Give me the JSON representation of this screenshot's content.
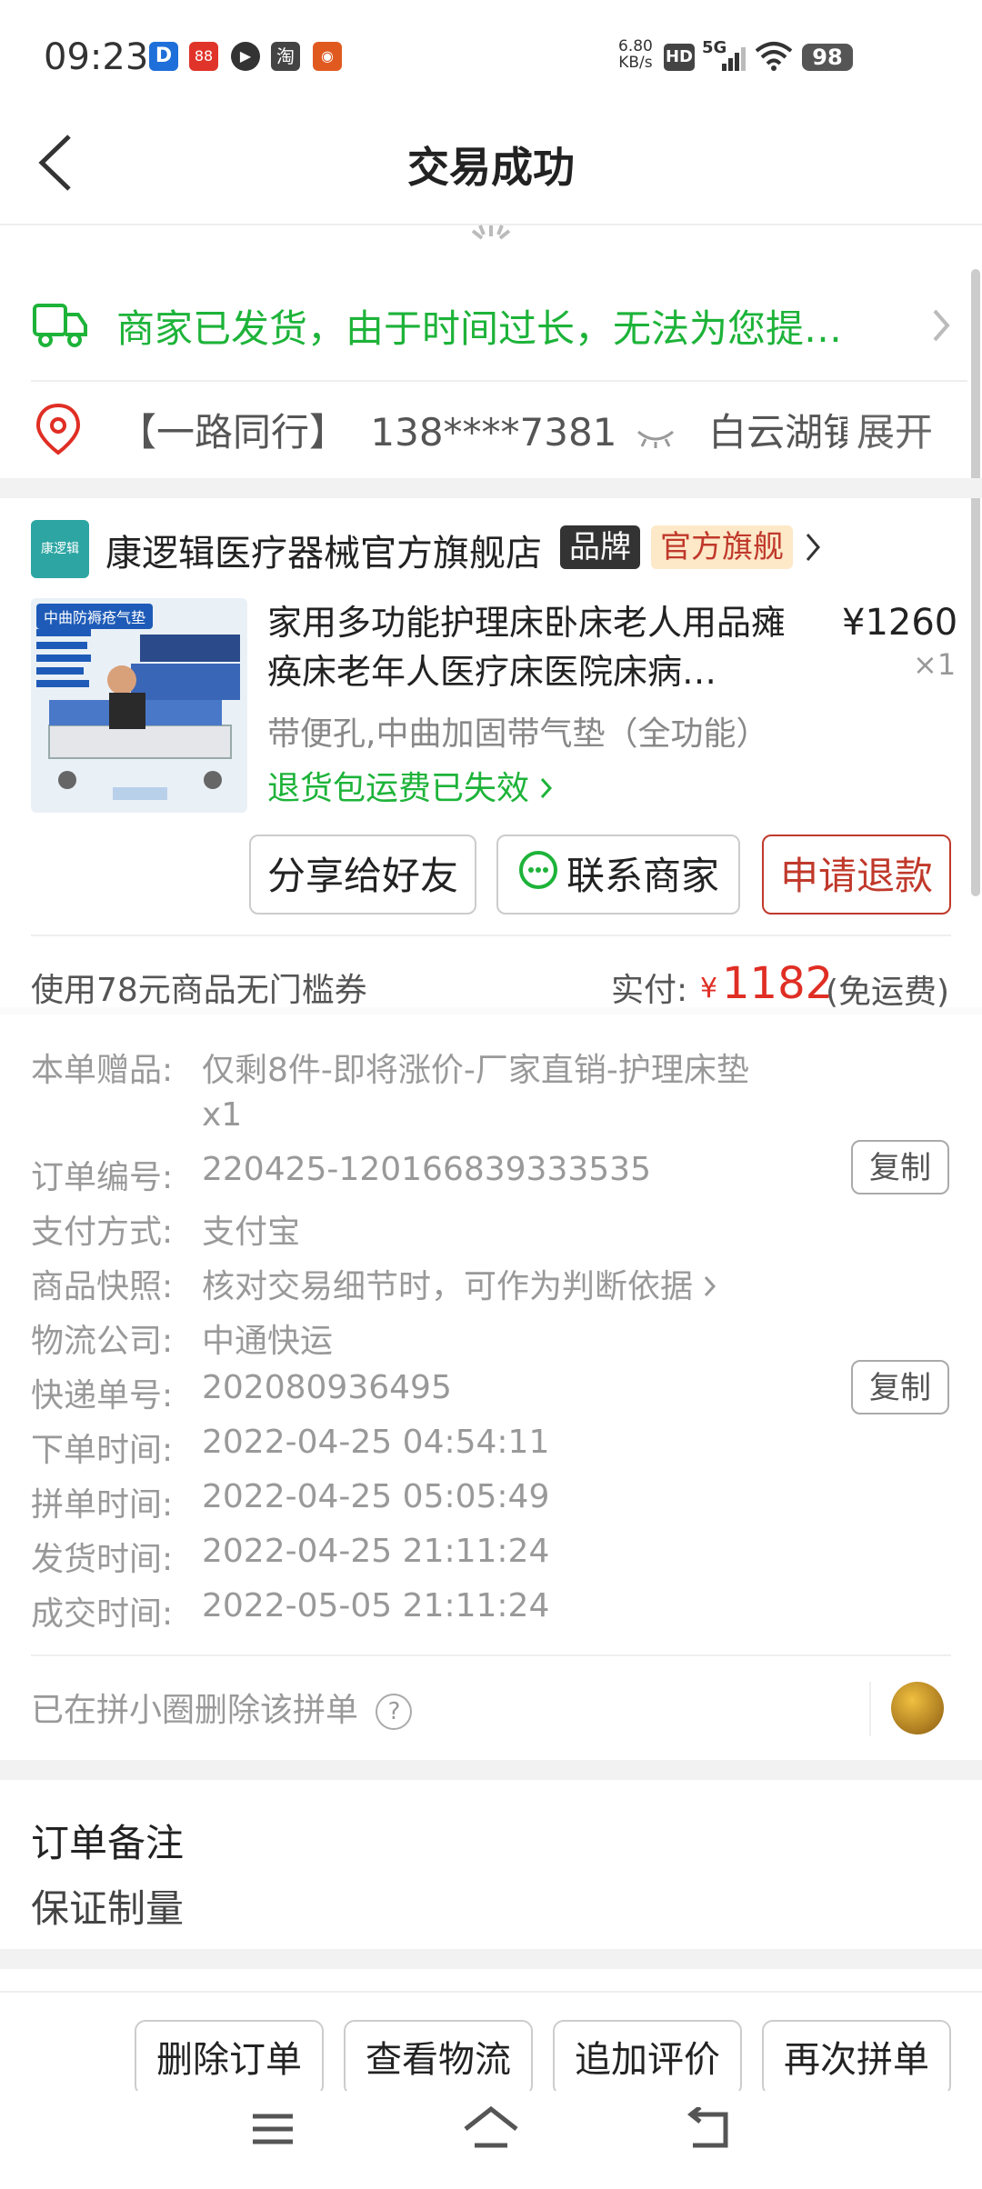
{
  "status": {
    "time": "09:23",
    "net_speed_value": "6.80",
    "net_speed_unit": "KB/s",
    "hd": "HD",
    "signal": "5G",
    "battery": "98",
    "app_icons": [
      "D",
      "88",
      "▶",
      "淘",
      "◉"
    ]
  },
  "nav": {
    "title": "交易成功"
  },
  "logistics": {
    "text": "商家已发货，由于时间过长，无法为您提…"
  },
  "address": {
    "name": "【一路同行】",
    "phone": "138****7381",
    "addr": "白云湖镇",
    "expand": "展开"
  },
  "store": {
    "logo_text": "康逻辑",
    "name": "康逻辑医疗器械官方旗舰店",
    "tag_brand": "品牌",
    "tag_flagship": "官方旗舰"
  },
  "product": {
    "title": "家用多功能护理床卧床老人用品瘫痪床老年人医疗床医院床病…",
    "price": "¥1260",
    "qty": "×1",
    "spec": "带便孔,中曲加固带气垫（全功能）",
    "refund_info": "退货包运费已失效",
    "image_label": "中曲防褥疮气垫"
  },
  "actions": {
    "share": "分享给好友",
    "contact": "联系商家",
    "refund": "申请退款"
  },
  "payment": {
    "coupon": "使用78元商品无门槛券",
    "paid_label": "实付:",
    "paid_yen": "¥",
    "paid_amount": "1182",
    "paid_note": "(免运费)"
  },
  "details": [
    {
      "label": "本单赠品:",
      "value": "仅剩8件-即将涨价-厂家直销-护理床垫"
    },
    {
      "label": "",
      "value": "x1"
    },
    {
      "label": "订单编号:",
      "value": "220425-120166839333535"
    },
    {
      "label": "支付方式:",
      "value": "支付宝"
    },
    {
      "label": "商品快照:",
      "value": "核对交易细节时，可作为判断依据"
    },
    {
      "label": "物流公司:",
      "value": "中通快运"
    },
    {
      "label": "快递单号:",
      "value": "202080936495"
    },
    {
      "label": "下单时间:",
      "value": "2022-04-25 04:54:11"
    },
    {
      "label": "拼单时间:",
      "value": "2022-04-25 05:05:49"
    },
    {
      "label": "发货时间:",
      "value": "2022-04-25 21:11:24"
    },
    {
      "label": "成交时间:",
      "value": "2022-05-05 21:11:24"
    }
  ],
  "copy_label": "复制",
  "circle": {
    "text": "已在拼小圈删除该拼单",
    "help": "?"
  },
  "note": {
    "title": "订单备注",
    "value": "保证制量"
  },
  "bottom_buttons": {
    "delete": "删除订单",
    "logistics": "查看物流",
    "review": "追加评价",
    "rebuy": "再次拼单"
  }
}
